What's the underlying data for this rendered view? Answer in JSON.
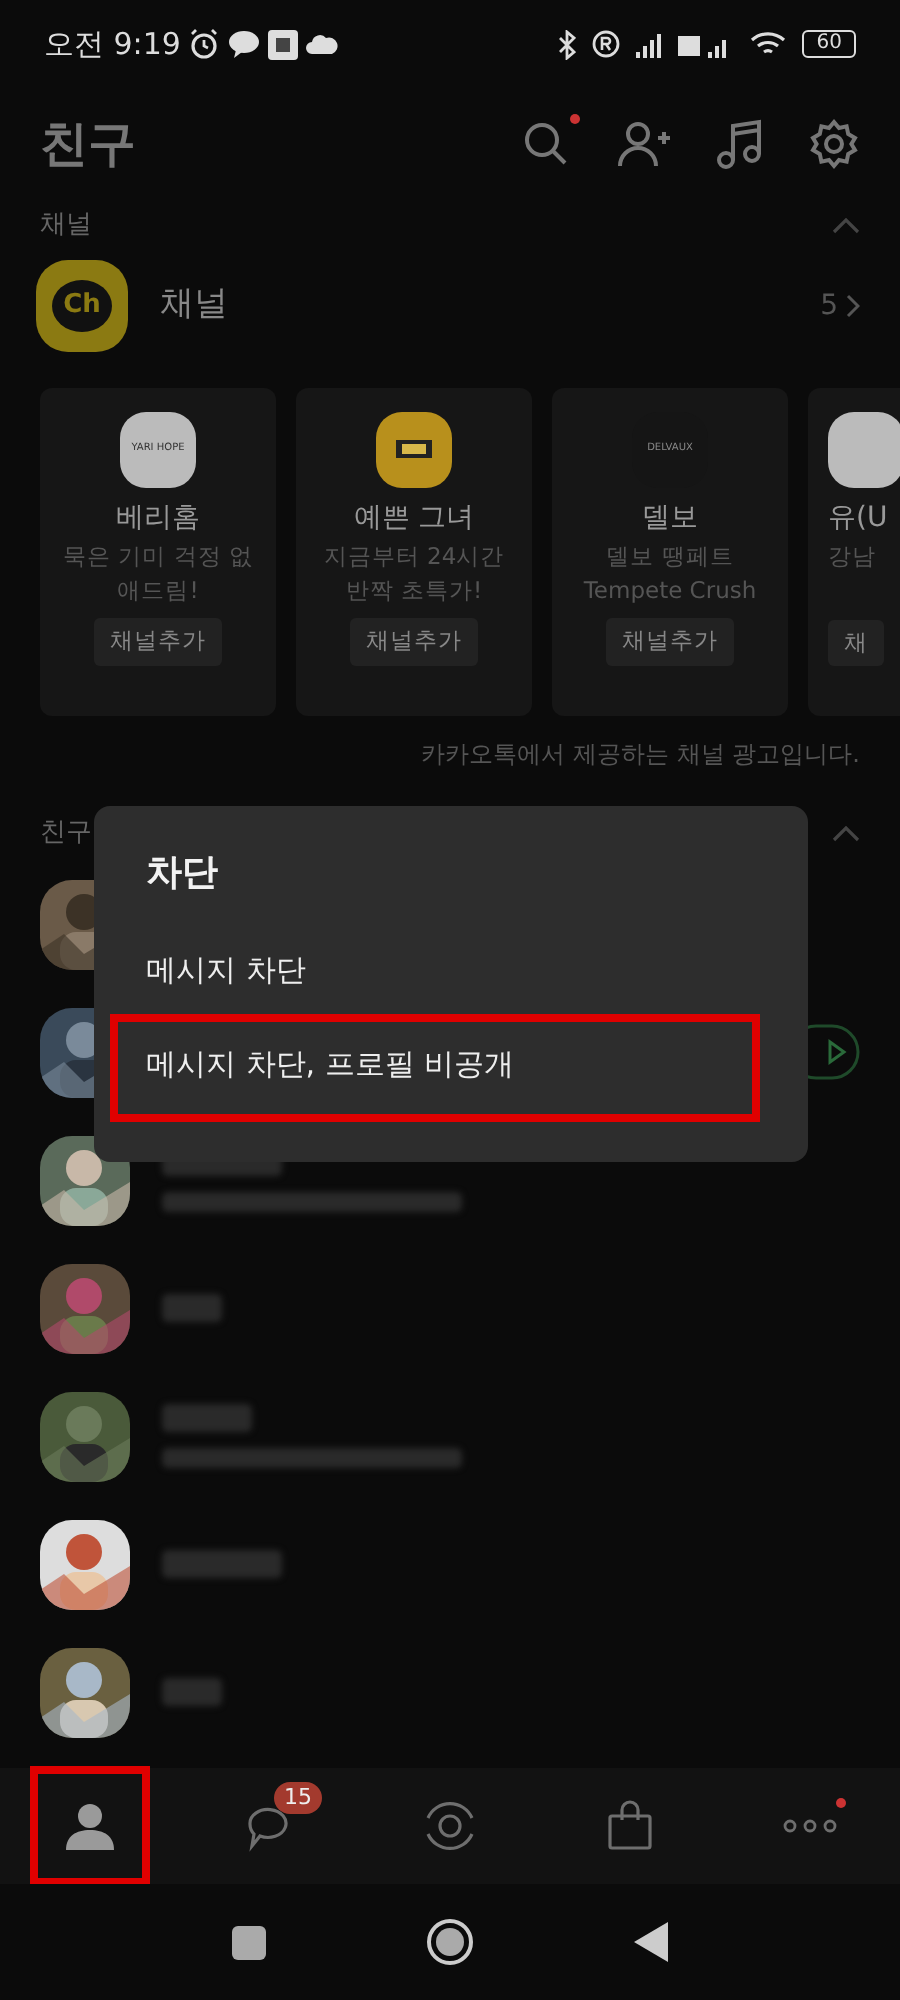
{
  "status_bar": {
    "time": "오전 9:19",
    "battery": "60"
  },
  "header": {
    "title": "친구",
    "search_new": true
  },
  "channel_section": {
    "label": "채널",
    "expanded": true,
    "row_label": "채널",
    "logo_text": "Ch",
    "count": "5"
  },
  "channel_cards": [
    {
      "color": "#bbbbbb",
      "logo_text": "YARI HOPE",
      "name": "베리홈",
      "line_1": "묵은 기미 걱정 없",
      "line_2": "애드림!",
      "button": "채널추가",
      "partial": false
    },
    {
      "color": "#b8901c",
      "name": "예쁜 그녀",
      "line_1": "지금부터 24시간",
      "line_2": "반짝 초특가!",
      "button": "채널추가",
      "partial": false
    },
    {
      "color": "#151515",
      "logo_text": "DELVAUX",
      "name": "델보",
      "line_1": "델보 땡페트",
      "line_2": "Tempete Crush",
      "button": "채널추가",
      "partial": false
    },
    {
      "color": "#bbbbbb",
      "name": "유(U",
      "line_1": "강남",
      "button": "채",
      "partial": true
    }
  ],
  "ad_note": "카카오톡에서 제공하는 채널 광고입니다.",
  "friends_section": {
    "label": "친구",
    "expanded": true
  },
  "friends": [
    {
      "status_line": false,
      "music": false
    },
    {
      "status_line": false,
      "music": true
    },
    {
      "status_line": true,
      "music": false
    },
    {
      "status_line": false,
      "music": false
    },
    {
      "status_line": true,
      "music": false
    },
    {
      "status_line": false,
      "music": false
    },
    {
      "status_line": false,
      "music": false
    }
  ],
  "dialog": {
    "title": "차단",
    "options": [
      {
        "label": "메시지 차단",
        "highlighted": false
      },
      {
        "label": "메시지 차단, 프로필 비공개",
        "highlighted": true
      }
    ]
  },
  "tabs": [
    {
      "kind": "friends",
      "selected": true,
      "highlighted": true
    },
    {
      "kind": "chats",
      "selected": false,
      "highlighted": false,
      "badge": "15"
    },
    {
      "kind": "view",
      "selected": false,
      "highlighted": false
    },
    {
      "kind": "shopping",
      "selected": false,
      "highlighted": false
    },
    {
      "kind": "more",
      "selected": false,
      "highlighted": false,
      "new": true
    }
  ]
}
